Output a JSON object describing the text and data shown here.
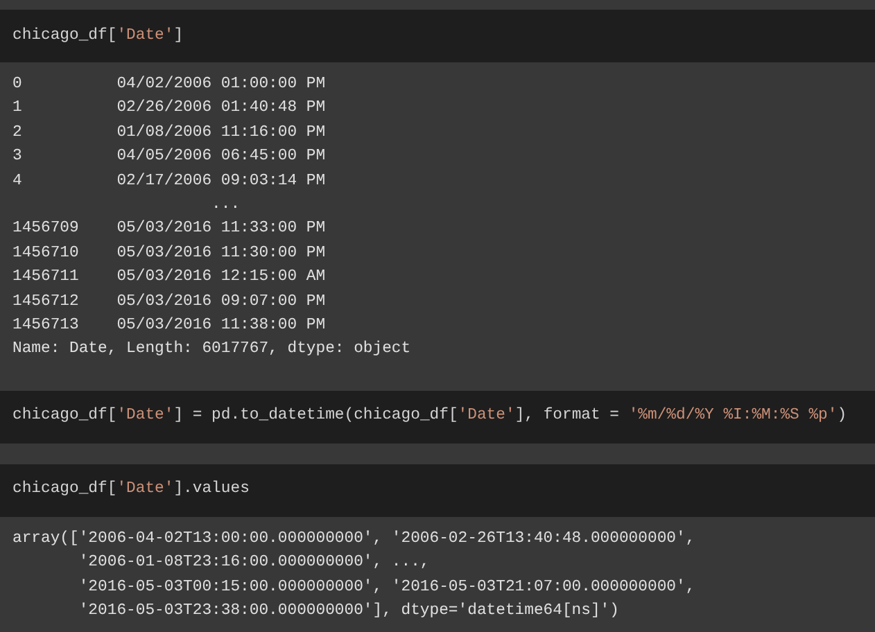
{
  "cells": [
    {
      "input": [
        {
          "kind": "code",
          "text": "chicago_df["
        },
        {
          "kind": "string",
          "text": "'Date'"
        },
        {
          "kind": "code",
          "text": "]"
        }
      ],
      "output": [
        "0          04/02/2006 01:00:00 PM",
        "1          02/26/2006 01:40:48 PM",
        "2          01/08/2006 11:16:00 PM",
        "3          04/05/2006 06:45:00 PM",
        "4          02/17/2006 09:03:14 PM",
        "                     ...",
        "1456709    05/03/2016 11:33:00 PM",
        "1456710    05/03/2016 11:30:00 PM",
        "1456711    05/03/2016 12:15:00 AM",
        "1456712    05/03/2016 09:07:00 PM",
        "1456713    05/03/2016 11:38:00 PM",
        "Name: Date, Length: 6017767, dtype: object"
      ]
    },
    {
      "input": [
        {
          "kind": "code",
          "text": "chicago_df["
        },
        {
          "kind": "string",
          "text": "'Date'"
        },
        {
          "kind": "code",
          "text": "] = pd.to_datetime(chicago_df["
        },
        {
          "kind": "string",
          "text": "'Date'"
        },
        {
          "kind": "code",
          "text": "], format = "
        },
        {
          "kind": "string",
          "text": "'%m/%d/%Y %I:%M:%S %p'"
        },
        {
          "kind": "code",
          "text": ")"
        }
      ]
    },
    {
      "input": [
        {
          "kind": "code",
          "text": "chicago_df["
        },
        {
          "kind": "string",
          "text": "'Date'"
        },
        {
          "kind": "code",
          "text": "].values"
        }
      ],
      "output": [
        "array(['2006-04-02T13:00:00.000000000', '2006-02-26T13:40:48.000000000',",
        "       '2006-01-08T23:16:00.000000000', ...,",
        "       '2016-05-03T00:15:00.000000000', '2016-05-03T21:07:00.000000000',",
        "       '2016-05-03T23:38:00.000000000'], dtype='datetime64[ns]')"
      ]
    }
  ]
}
